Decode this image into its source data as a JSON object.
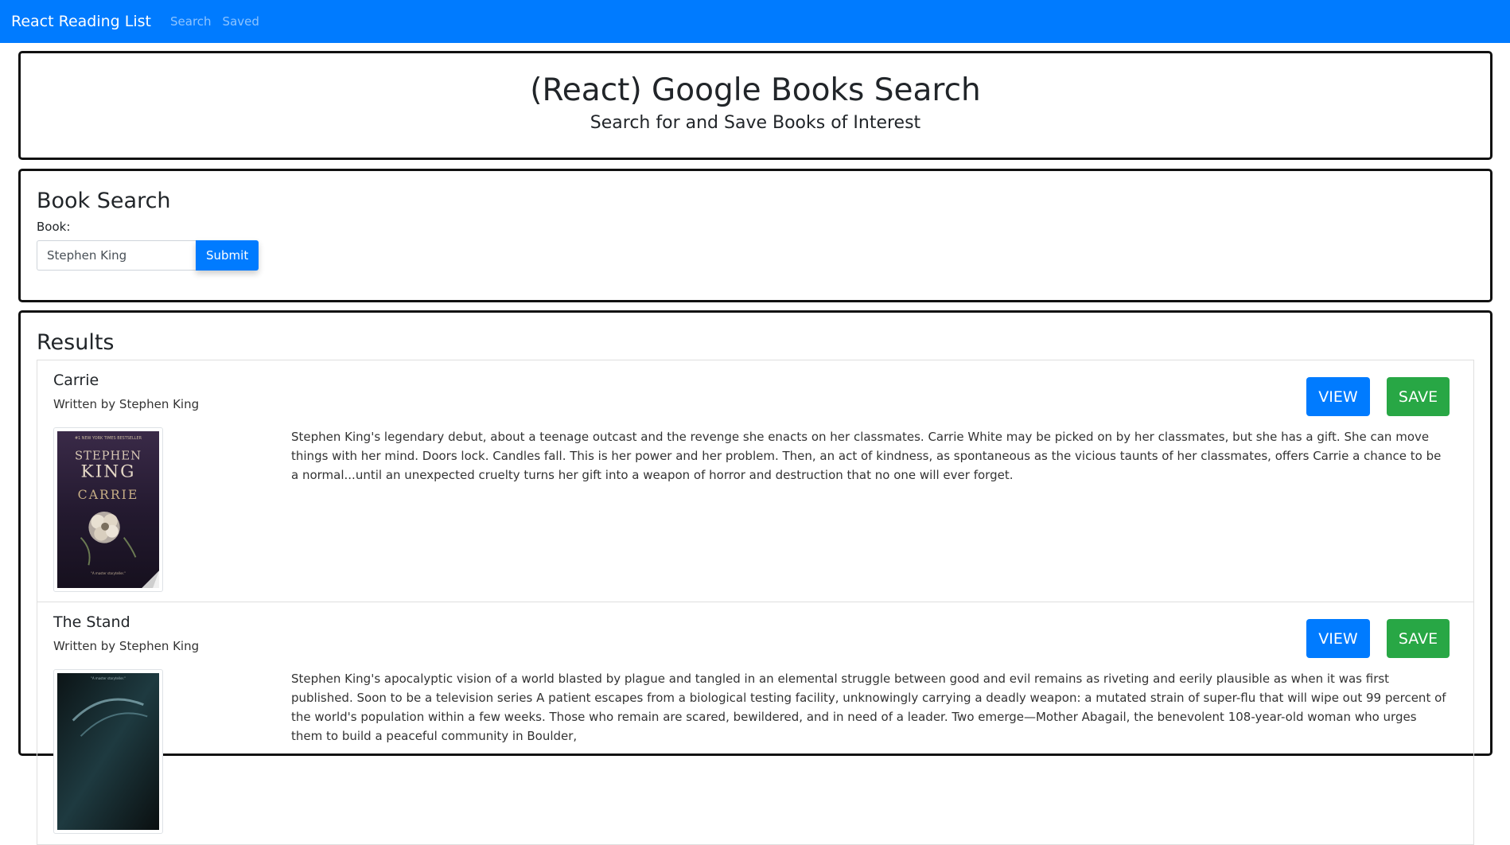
{
  "navbar": {
    "brand": "React Reading List",
    "links": [
      "Search",
      "Saved"
    ]
  },
  "jumbotron": {
    "title": "(React) Google Books Search",
    "subtitle": "Search for and Save Books of Interest"
  },
  "search": {
    "heading": "Book Search",
    "label": "Book:",
    "value": "Stephen King",
    "submit_label": "Submit"
  },
  "results": {
    "heading": "Results",
    "items": [
      {
        "title": "Carrie",
        "author": "Written by Stephen King",
        "description": "Stephen King's legendary debut, about a teenage outcast and the revenge she enacts on her classmates. Carrie White may be picked on by her classmates, but she has a gift. She can move things with her mind. Doors lock. Candles fall. This is her power and her problem. Then, an act of kindness, as spontaneous as the vicious taunts of her classmates, offers Carrie a chance to be a normal...until an unexpected cruelty turns her gift into a weapon of horror and destruction that no one will ever forget.",
        "view_label": "VIEW",
        "save_label": "SAVE",
        "cover": {
          "top_text": "#1 NEW YORK TIMES BESTSELLER",
          "author_line1": "STEPHEN",
          "author_line2": "KING",
          "title": "CARRIE"
        }
      },
      {
        "title": "The Stand",
        "author": "Written by Stephen King",
        "description": "Stephen King's apocalyptic vision of a world blasted by plague and tangled in an elemental struggle between good and evil remains as riveting and eerily plausible as when it was first published. Soon to be a television series A patient escapes from a biological testing facility, unknowingly carrying a deadly weapon: a mutated strain of super-flu that will wipe out 99 percent of the world's population within a few weeks. Those who remain are scared, bewildered, and in need of a leader. Two emerge—Mother Abagail, the benevolent 108-year-old woman who urges them to build a peaceful community in Boulder,",
        "view_label": "VIEW",
        "save_label": "SAVE"
      }
    ]
  },
  "colors": {
    "primary": "#007bff",
    "success": "#28a745",
    "border_dark": "#111111"
  }
}
